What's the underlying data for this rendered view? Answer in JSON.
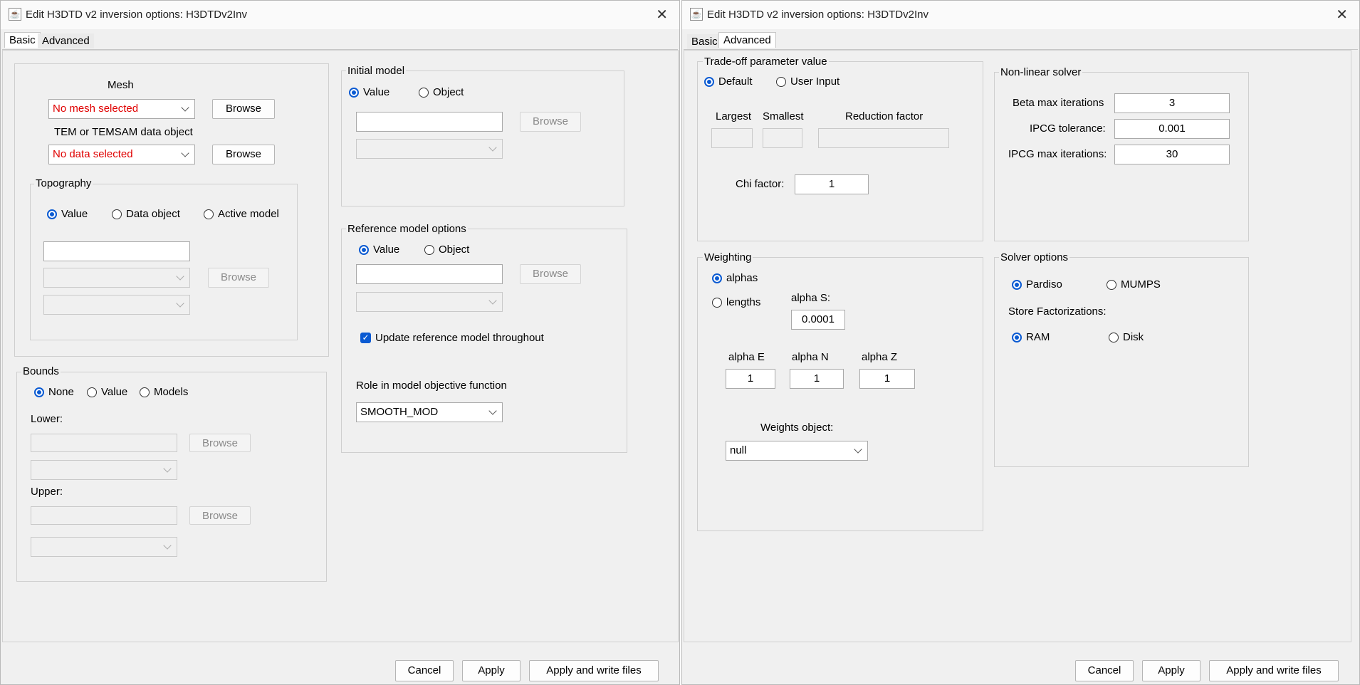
{
  "left": {
    "title": "Edit H3DTD v2 inversion options: H3DTDv2Inv",
    "tabs": [
      "Basic",
      "Advanced"
    ],
    "mesh": {
      "label": "Mesh",
      "value": "No mesh selected",
      "browse": "Browse"
    },
    "data_object": {
      "label": "TEM or TEMSAM data object",
      "value": "No data selected",
      "browse": "Browse"
    },
    "topography": {
      "label": "Topography",
      "options": [
        "Value",
        "Data object",
        "Active model"
      ],
      "selected": "Value",
      "value": "",
      "browse": "Browse"
    },
    "bounds": {
      "label": "Bounds",
      "options": [
        "None",
        "Value",
        "Models"
      ],
      "selected": "None",
      "lower_label": "Lower:",
      "upper_label": "Upper:",
      "browse": "Browse"
    },
    "initial_model": {
      "label": "Initial model",
      "options": [
        "Value",
        "Object"
      ],
      "selected": "Value",
      "value": "",
      "browse": "Browse"
    },
    "reference_model": {
      "label": "Reference model options",
      "options": [
        "Value",
        "Object"
      ],
      "selected": "Value",
      "value": "",
      "browse": "Browse",
      "update_checkbox": "Update reference model throughout",
      "update_checked": true,
      "role_label": "Role in model objective function",
      "role_value": "SMOOTH_MOD"
    },
    "buttons": {
      "cancel": "Cancel",
      "apply": "Apply",
      "apply_write": "Apply and write files"
    }
  },
  "right": {
    "title": "Edit H3DTD v2 inversion options: H3DTDv2Inv",
    "tabs": [
      "Basic",
      "Advanced"
    ],
    "tradeoff": {
      "label": "Trade-off parameter value",
      "options": [
        "Default",
        "User Input"
      ],
      "selected": "Default",
      "largest": "Largest",
      "smallest": "Smallest",
      "reduction": "Reduction factor",
      "chi_label": "Chi factor:",
      "chi_value": "1"
    },
    "nonlinear": {
      "label": "Non-linear solver",
      "beta_label": "Beta max iterations",
      "beta_value": "3",
      "ipcg_tol_label": "IPCG tolerance:",
      "ipcg_tol_value": "0.001",
      "ipcg_max_label": "IPCG max iterations:",
      "ipcg_max_value": "30"
    },
    "weighting": {
      "label": "Weighting",
      "options": [
        "alphas",
        "lengths"
      ],
      "selected": "alphas",
      "alpha_s_label": "alpha S:",
      "alpha_s_value": "0.0001",
      "alpha_e_label": "alpha E",
      "alpha_e_value": "1",
      "alpha_n_label": "alpha N",
      "alpha_n_value": "1",
      "alpha_z_label": "alpha Z",
      "alpha_z_value": "1",
      "weights_label": "Weights object:",
      "weights_value": "null"
    },
    "solver": {
      "label": "Solver options",
      "options": [
        "Pardiso",
        "MUMPS"
      ],
      "selected": "Pardiso",
      "store_label": "Store Factorizations:",
      "store_options": [
        "RAM",
        "Disk"
      ],
      "store_selected": "RAM"
    },
    "buttons": {
      "cancel": "Cancel",
      "apply": "Apply",
      "apply_write": "Apply and write files"
    }
  }
}
